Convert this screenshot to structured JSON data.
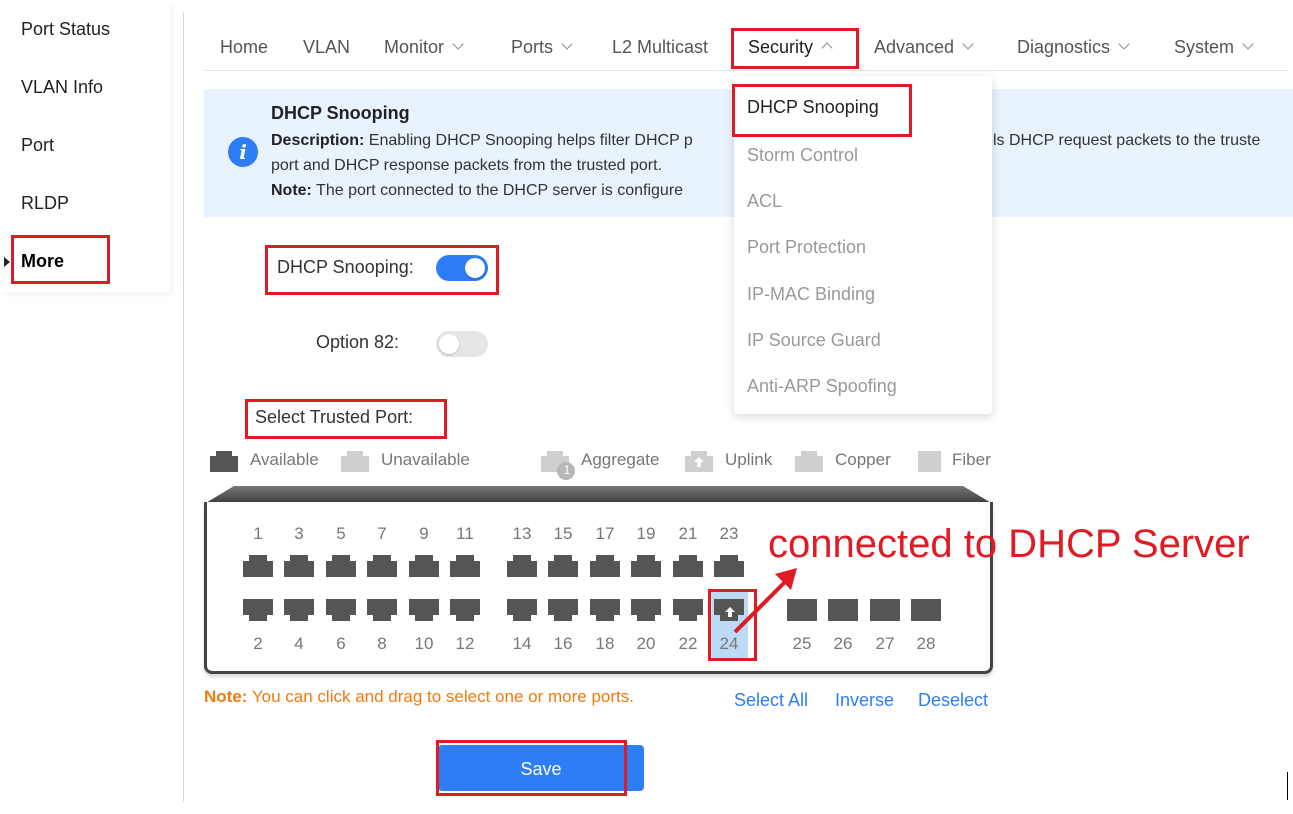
{
  "sidebar": {
    "items": [
      {
        "label": "Port Status"
      },
      {
        "label": "VLAN Info"
      },
      {
        "label": "Port"
      },
      {
        "label": "RLDP"
      },
      {
        "label": "More"
      }
    ]
  },
  "nav": {
    "items": [
      {
        "label": "Home"
      },
      {
        "label": "VLAN"
      },
      {
        "label": "Monitor"
      },
      {
        "label": "Ports"
      },
      {
        "label": "L2 Multicast"
      },
      {
        "label": "Security"
      },
      {
        "label": "Advanced"
      },
      {
        "label": "Diagnostics"
      },
      {
        "label": "System"
      }
    ]
  },
  "dropdown": {
    "items": [
      {
        "label": "DHCP Snooping"
      },
      {
        "label": "Storm Control"
      },
      {
        "label": "ACL"
      },
      {
        "label": "Port Protection"
      },
      {
        "label": "IP-MAC Binding"
      },
      {
        "label": "IP Source Guard"
      },
      {
        "label": "Anti-ARP Spoofing"
      }
    ]
  },
  "banner": {
    "title": "DHCP Snooping",
    "desc_label": "Description:",
    "desc_text": " Enabling DHCP Snooping helps filter DHCP p",
    "desc_tail": "ls DHCP request packets to the truste",
    "desc_line2": "port and DHCP response packets from the trusted port.",
    "note_label": "Note:",
    "note_text": " The port connected to the DHCP server is configure"
  },
  "form": {
    "dhcp_snooping_label": "DHCP Snooping:",
    "dhcp_snooping_on": true,
    "option82_label": "Option 82:",
    "option82_on": false,
    "trusted_label": "Select Trusted Port:"
  },
  "legend": {
    "available": "Available",
    "unavailable": "Unavailable",
    "aggregate": "Aggregate",
    "aggregate_badge": "1",
    "uplink": "Uplink",
    "copper": "Copper",
    "fiber": "Fiber"
  },
  "ports": {
    "top": [
      "1",
      "3",
      "5",
      "7",
      "9",
      "11",
      "13",
      "15",
      "17",
      "19",
      "21",
      "23"
    ],
    "bottom": [
      "2",
      "4",
      "6",
      "8",
      "10",
      "12",
      "14",
      "16",
      "18",
      "20",
      "22",
      "24"
    ],
    "fiber": [
      "25",
      "26",
      "27",
      "28"
    ],
    "selected": "24"
  },
  "annotation": {
    "text": "connected to DHCP Server",
    "color": "#e01b24"
  },
  "note": {
    "label": "Note:",
    "text": " You can click and drag to select one or more ports."
  },
  "links": {
    "select_all": "Select All",
    "inverse": "Inverse",
    "deselect": "Deselect"
  },
  "save_label": "Save",
  "colors": {
    "accent": "#2d7df6",
    "highlight": "#e01b24",
    "warning": "#ef7a0f"
  }
}
